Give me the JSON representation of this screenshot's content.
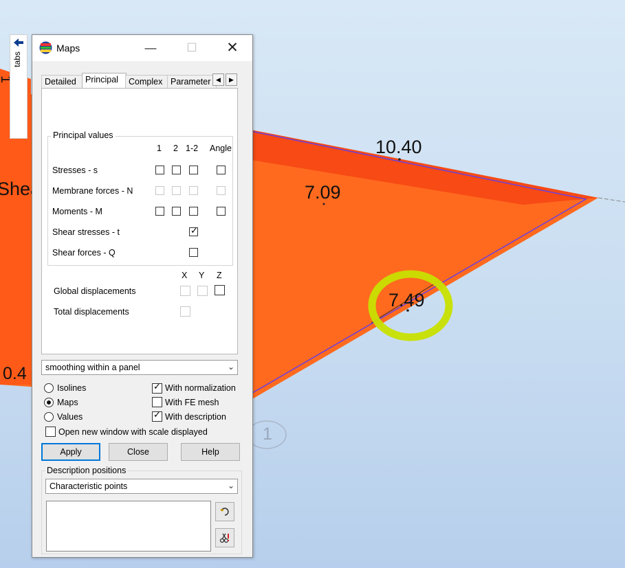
{
  "viewport": {
    "labels": [
      "10.40",
      "7.09",
      "7.49",
      "Shea",
      "0.4",
      "1",
      "1"
    ],
    "colors": {
      "fill_main": "#ff6a1f",
      "fill_edge": "#f74a14",
      "outline": "#6a3fe0",
      "highlight": "#c8e000"
    }
  },
  "side_tab": {
    "label": "tabs",
    "icon": "arrow-left-icon"
  },
  "dialog": {
    "title": "Maps",
    "title_icon": "maps-app-icon",
    "tabs": [
      "Detailed",
      "Principal",
      "Complex",
      "Parameter"
    ],
    "active_tab": "Principal",
    "principal_values": {
      "legend": "Principal values",
      "columns": [
        "1",
        "2",
        "1-2",
        "Angle"
      ],
      "rows": [
        {
          "label": "Stresses - s",
          "enabled": true
        },
        {
          "label": "Membrane forces - N",
          "enabled": false
        },
        {
          "label": "Moments - M",
          "enabled": true
        },
        {
          "label": "Shear stresses - t",
          "checked": true
        },
        {
          "label": "Shear forces - Q",
          "checked": false
        }
      ]
    },
    "displacements": {
      "columns": [
        "X",
        "Y",
        "Z"
      ],
      "global_label": "Global displacements",
      "total_label": "Total displacements"
    },
    "smoothing": "smoothing within a panel",
    "mode_options": [
      {
        "label": "Isolines",
        "selected": false
      },
      {
        "label": "Maps",
        "selected": true
      },
      {
        "label": "Values",
        "selected": false
      }
    ],
    "flags": [
      {
        "label": "With normalization",
        "checked": true
      },
      {
        "label": "With FE mesh",
        "checked": false
      },
      {
        "label": "With description",
        "checked": true
      }
    ],
    "open_new_window": {
      "label": "Open new window with scale displayed",
      "checked": false
    },
    "buttons": {
      "apply": "Apply",
      "close": "Close",
      "help": "Help"
    },
    "description_positions": {
      "legend": "Description positions",
      "value": "Characteristic points"
    }
  }
}
